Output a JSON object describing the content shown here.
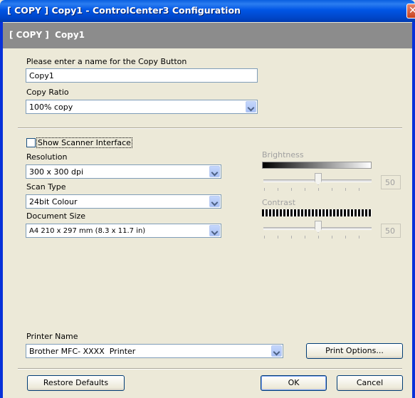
{
  "window": {
    "title": "[ COPY ]  Copy1 - ControlCenter3 Configuration",
    "close_glyph": "✕"
  },
  "banner": {
    "text": "[ COPY ]  Copy1"
  },
  "copy_button": {
    "label": "Please enter a name for the Copy Button",
    "value": "Copy1"
  },
  "copy_ratio": {
    "label": "Copy Ratio",
    "value": "100% copy"
  },
  "scanner": {
    "show_interface_label": "Show Scanner Interface",
    "show_interface_checked": false,
    "resolution_label": "Resolution",
    "resolution_value": "300 x 300 dpi",
    "scan_type_label": "Scan Type",
    "scan_type_value": "24bit Colour",
    "document_size_label": "Document Size",
    "document_size_value": "A4 210 x 297 mm (8.3 x 11.7 in)",
    "brightness_label": "Brightness",
    "brightness_value": "50",
    "contrast_label": "Contrast",
    "contrast_value": "50"
  },
  "printer": {
    "label": "Printer Name",
    "value": "Brother MFC- XXXX  Printer",
    "options_button": "Print Options..."
  },
  "footer": {
    "restore_button": "Restore Defaults",
    "ok_button": "OK",
    "cancel_button": "Cancel"
  },
  "colors": {
    "titlebar": "#0055e5",
    "banner": "#8c8c8c",
    "dialog_bg": "#ece9d8"
  }
}
